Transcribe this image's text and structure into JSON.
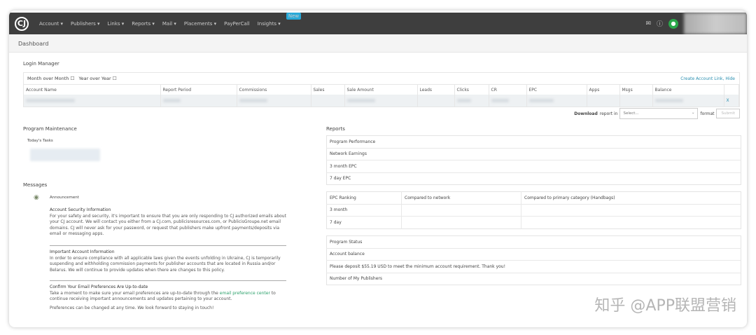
{
  "nav": {
    "logo": "CJ",
    "items": [
      "Account ▾",
      "Publishers ▾",
      "Links ▾",
      "Reports ▾",
      "Mail ▾",
      "Placements ▾",
      "PayPerCall",
      "Insights ▾"
    ],
    "new_badge": "New"
  },
  "page_title": "Dashboard",
  "login_manager": {
    "title": "Login Manager",
    "month_over_month": "Month over Month",
    "year_over_year": "Year over Year",
    "create_link": "Create Account Link, Hide",
    "columns": [
      "Account Name",
      "Report Period",
      "Commissions",
      "Sales",
      "Sale Amount",
      "Leads",
      "Clicks",
      "CR",
      "EPC",
      "Apps",
      "Msgs",
      "Balance",
      ""
    ],
    "remove": "X"
  },
  "download": {
    "label_bold": "Download",
    "label": "report in",
    "select_placeholder": "Select...",
    "format": "format",
    "submit": "Submit"
  },
  "program_maintenance": {
    "title": "Program Maintenance",
    "tasks": "Today's Tasks"
  },
  "messages": {
    "title": "Messages",
    "announcement": "Announcement",
    "items": [
      {
        "title": "Account Security Information",
        "body": "For your safety and security, it's important to ensure that you are only responding to CJ authorized emails about your CJ account. We will contact you either from a CJ.com, publicisresources.com, or PublicisGroupe.net email domains. CJ will never ask for your password, or request that publishers make upfront payments/deposits via email or messaging apps."
      },
      {
        "title": "Important Account Information",
        "body": "In order to ensure compliance with all applicable laws given the events unfolding in Ukraine, CJ is temporarily suspending and withholding commission payments for publisher accounts that are located in Russia and/or Belarus. We will continue to provide updates when there are changes to this policy."
      },
      {
        "title": "Confirm Your Email Preferences Are Up-to-date",
        "body_pre": "Take a moment to make sure your email preferences are up-to-date through the ",
        "link": "email preference center",
        "body_post": " to continue receiving important announcements and updates pertaining to your account.",
        "extra": "Preferences can be changed at any time. We look forward to staying in touch!"
      }
    ]
  },
  "reports": {
    "title": "Reports",
    "performance": [
      "Program Performance",
      "Network Earnings",
      "3 month EPC",
      "7 day EPC"
    ],
    "ranking": {
      "headers": [
        "EPC Ranking",
        "Compared to network",
        "Compared to primary category (Handbags)"
      ],
      "rows": [
        "3 month",
        "7 day"
      ]
    },
    "status": [
      "Program Status",
      "Account balance",
      "Please deposit $55.19 USD to meet the minimum account requirement. Thank you!",
      "Number of My Publishers"
    ]
  },
  "watermark": "知乎 @APP联盟营销"
}
